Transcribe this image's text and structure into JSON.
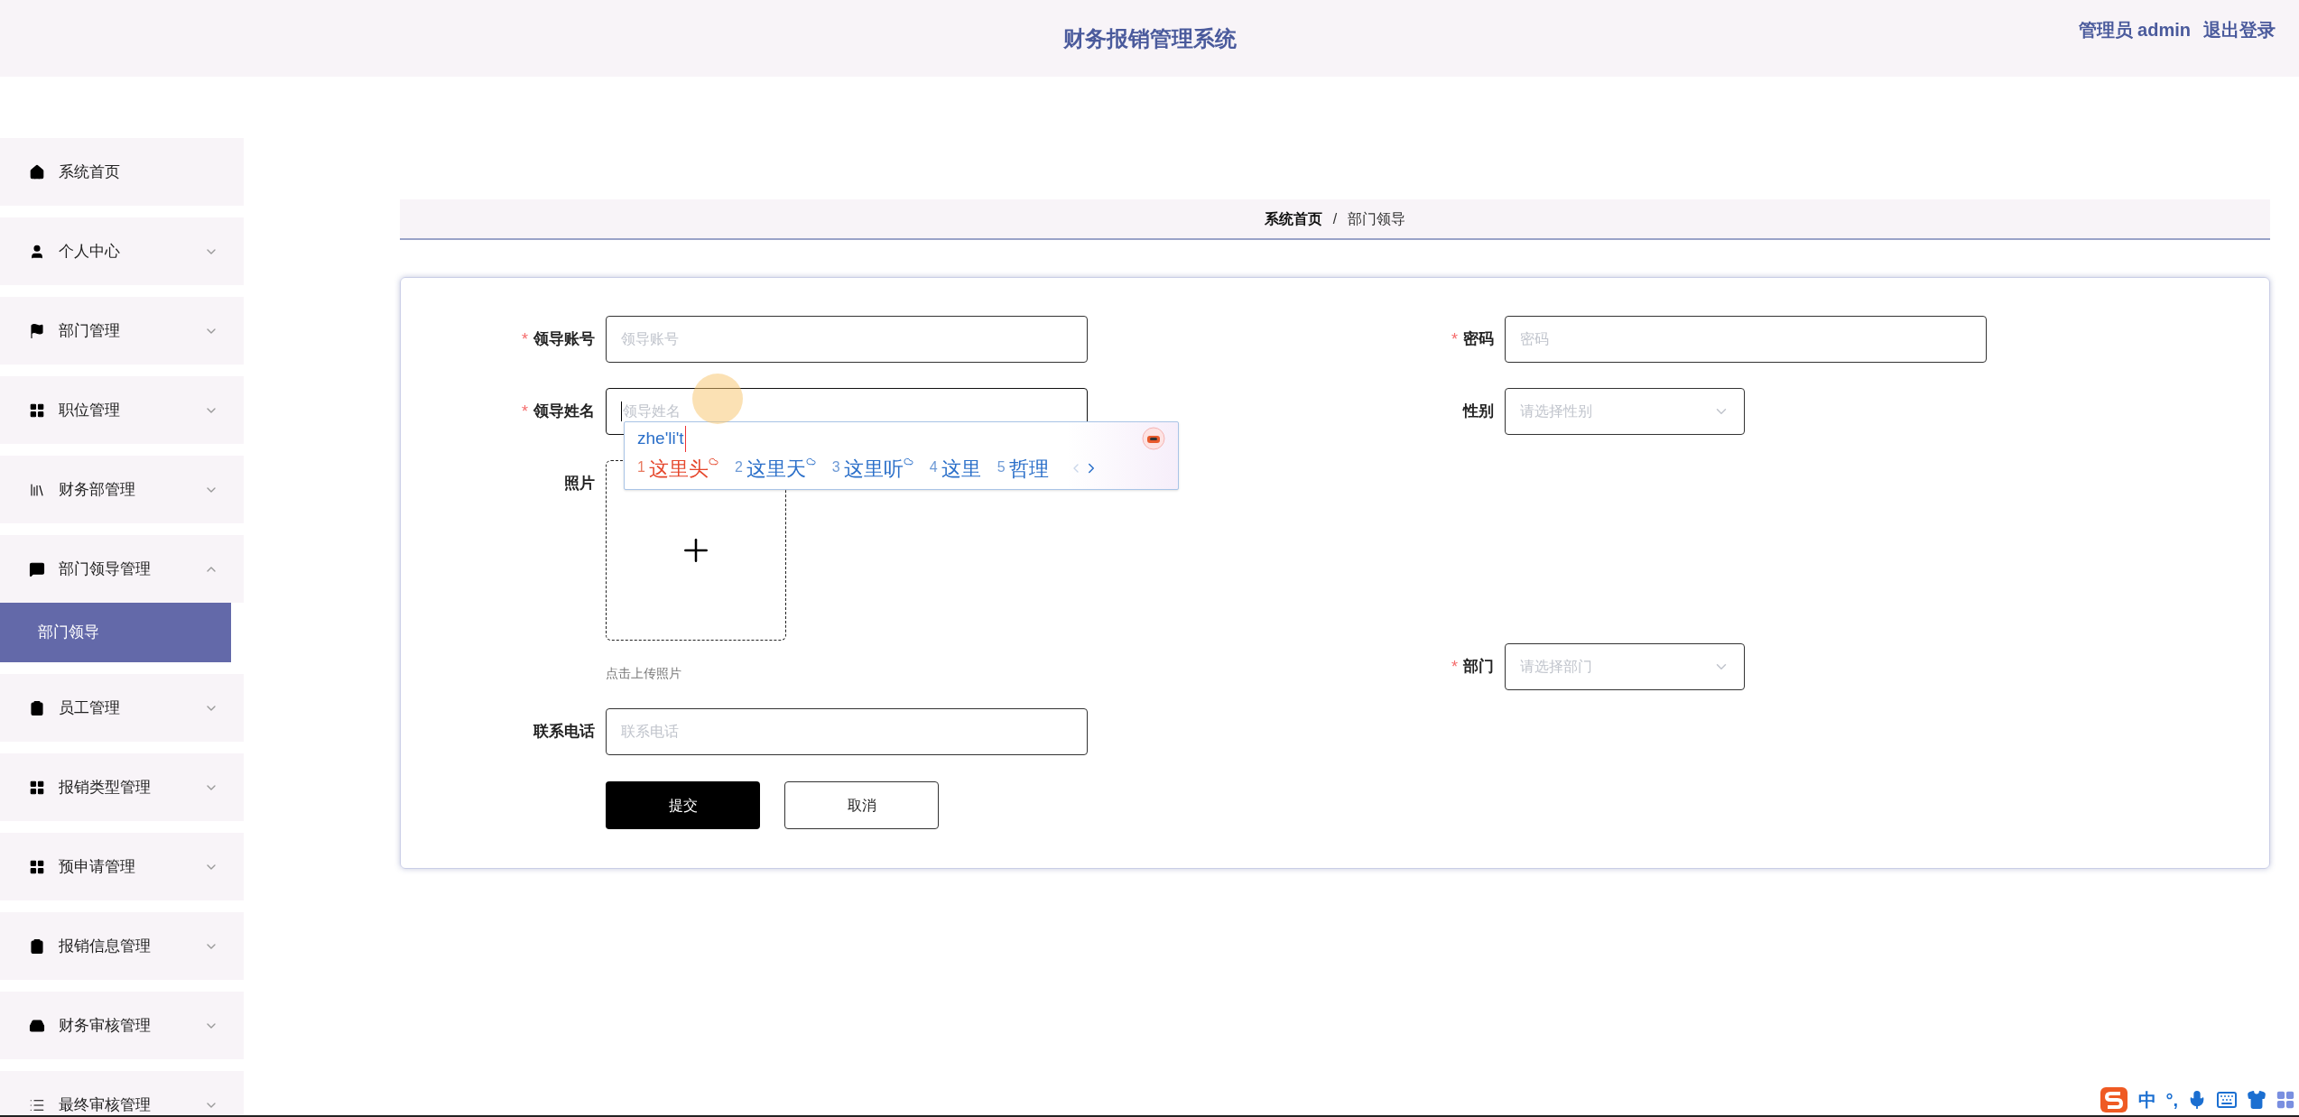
{
  "header": {
    "title": "财务报销管理系统",
    "user": "管理员 admin",
    "logout": "退出登录"
  },
  "sidebar": {
    "items": [
      {
        "label": "系统首页",
        "kind": "link"
      },
      {
        "label": "个人中心",
        "kind": "menu",
        "expanded": false
      },
      {
        "label": "部门管理",
        "kind": "menu",
        "expanded": false
      },
      {
        "label": "职位管理",
        "kind": "menu",
        "expanded": false
      },
      {
        "label": "财务部管理",
        "kind": "menu",
        "expanded": false
      },
      {
        "label": "部门领导管理",
        "kind": "menu",
        "expanded": true,
        "children": [
          {
            "label": "部门领导",
            "selected": true
          }
        ]
      },
      {
        "label": "员工管理",
        "kind": "menu",
        "expanded": false
      },
      {
        "label": "报销类型管理",
        "kind": "menu",
        "expanded": false
      },
      {
        "label": "预申请管理",
        "kind": "menu",
        "expanded": false
      },
      {
        "label": "报销信息管理",
        "kind": "menu",
        "expanded": false
      },
      {
        "label": "财务审核管理",
        "kind": "menu",
        "expanded": false
      },
      {
        "label": "最终审核管理",
        "kind": "menu",
        "expanded": false
      }
    ]
  },
  "breadcrumb": [
    {
      "label": "系统首页",
      "current": false
    },
    {
      "label": "部门领导",
      "current": true
    }
  ],
  "breadcrumb_separator": "/",
  "form": {
    "rows": [
      {
        "left": {
          "kind": "input",
          "label": "领导账号",
          "required": true,
          "placeholder": "领导账号",
          "focused": false
        },
        "right": {
          "kind": "input",
          "label": "密码",
          "required": true,
          "placeholder": "密码",
          "focused": false
        }
      },
      {
        "left": {
          "kind": "input",
          "label": "领导姓名",
          "required": true,
          "placeholder": "领导姓名",
          "focused": true
        },
        "right": {
          "kind": "select",
          "label": "性别",
          "required": false,
          "placeholder": "请选择性别"
        }
      },
      {
        "left": {
          "kind": "upload",
          "label": "照片",
          "required": false,
          "hint": "点击上传照片"
        },
        "right": {
          "kind": "select",
          "label": "部门",
          "required": true,
          "placeholder": "请选择部门"
        }
      },
      {
        "left": {
          "kind": "input",
          "label": "联系电话",
          "required": false,
          "placeholder": "联系电话",
          "focused": false
        }
      }
    ],
    "buttons": [
      {
        "label": "提交",
        "primary": true
      },
      {
        "label": "取消",
        "primary": false
      }
    ],
    "required_mark": "*"
  },
  "ime_popup": {
    "composition": "zhe'li't",
    "candidates": [
      {
        "number": "1",
        "text": "这里头",
        "selected": true,
        "cloud": true
      },
      {
        "number": "2",
        "text": "这里天",
        "selected": false,
        "cloud": true
      },
      {
        "number": "3",
        "text": "这里听",
        "selected": false,
        "cloud": true
      },
      {
        "number": "4",
        "text": "这里",
        "selected": false,
        "cloud": false
      },
      {
        "number": "5",
        "text": "哲理",
        "selected": false,
        "cloud": false
      }
    ]
  },
  "ime_toolbar": {
    "mode": "中",
    "punctuation": "°,"
  }
}
